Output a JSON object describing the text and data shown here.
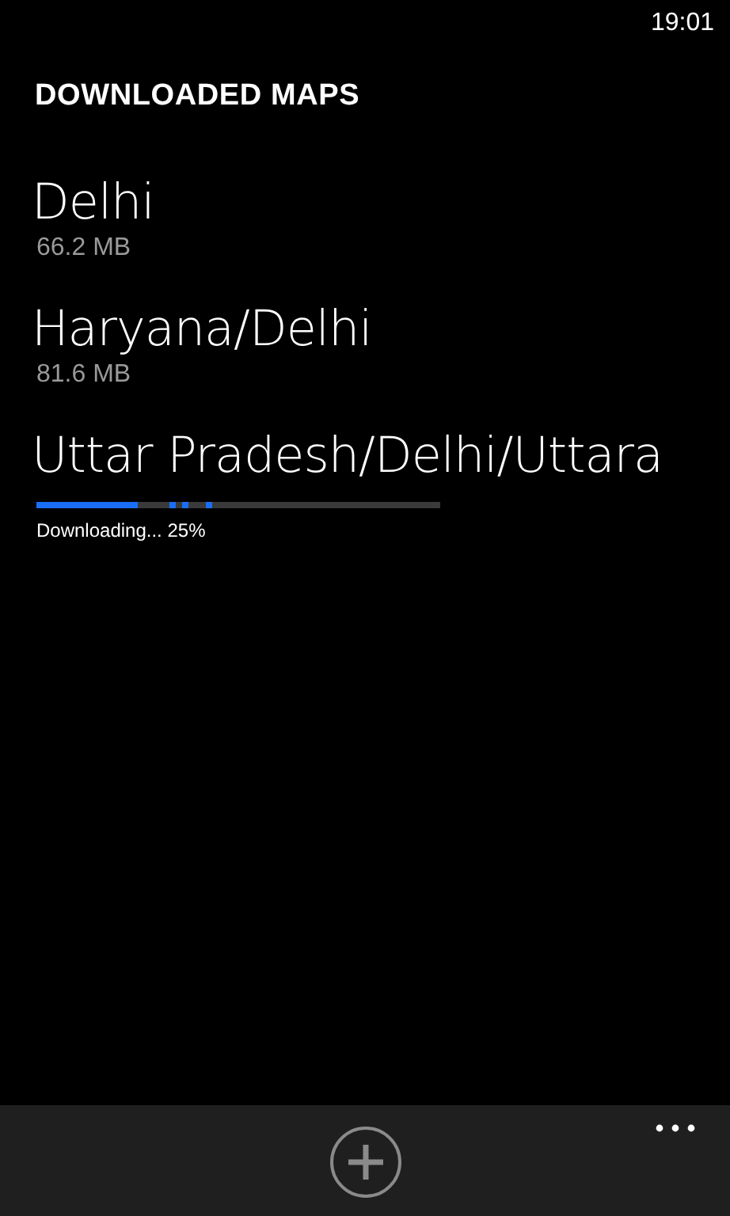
{
  "status_bar": {
    "time": "19:01"
  },
  "page": {
    "title": "DOWNLOADED MAPS"
  },
  "maps": [
    {
      "kind": "downloaded",
      "name": "Delhi",
      "size": "66.2 MB"
    },
    {
      "kind": "downloaded",
      "name": "Haryana/Delhi",
      "size": "81.6 MB"
    },
    {
      "kind": "downloading",
      "name": "Uttar Pradesh/Delhi/Uttara",
      "level": 0.25,
      "status": "Downloading... 25%"
    }
  ]
}
